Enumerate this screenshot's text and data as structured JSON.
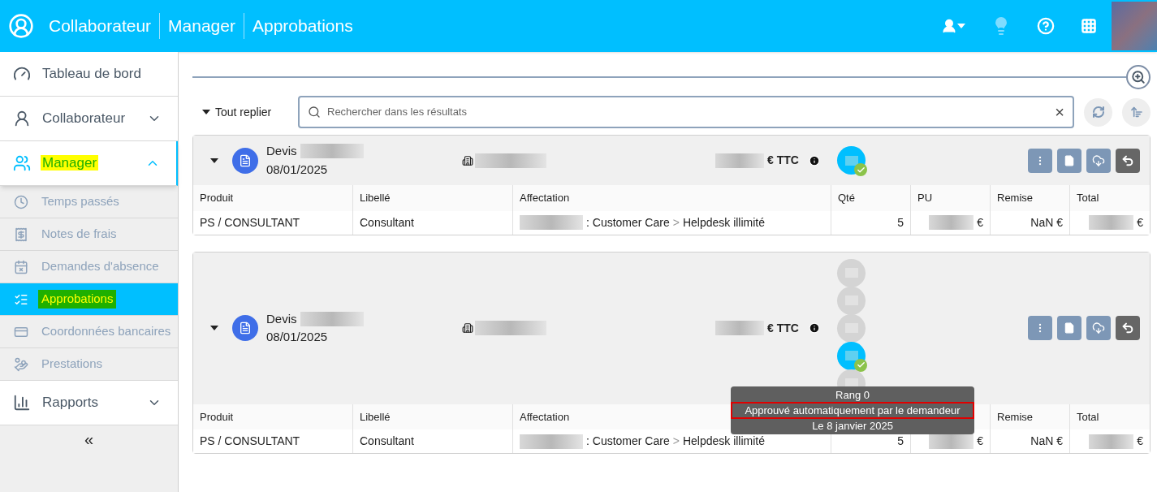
{
  "header": {
    "breadcrumb": [
      "Collaborateur",
      "Manager",
      "Approbations"
    ]
  },
  "sidebar": {
    "items": [
      {
        "label": "Tableau de bord",
        "kind": "section",
        "selected": false,
        "highlighted": false
      },
      {
        "label": "Collaborateur",
        "kind": "section",
        "selected": false,
        "highlighted": false,
        "expanded": false
      },
      {
        "label": "Manager",
        "kind": "section",
        "selected": true,
        "expanded": true,
        "highlighted": true,
        "children": [
          {
            "label": "Temps passés",
            "kind": "sub",
            "selected": false,
            "highlighted": false
          },
          {
            "label": "Notes de frais",
            "kind": "sub",
            "selected": false,
            "highlighted": false
          },
          {
            "label": "Demandes d'absence",
            "kind": "sub",
            "selected": false,
            "highlighted": false
          },
          {
            "label": "Approbations",
            "kind": "sub",
            "selected": true,
            "highlighted": true
          },
          {
            "label": "Coordonnées bancaires",
            "kind": "sub",
            "selected": false,
            "highlighted": false
          },
          {
            "label": "Prestations",
            "kind": "sub",
            "selected": false,
            "highlighted": false
          }
        ]
      },
      {
        "label": "Rapports",
        "kind": "section",
        "selected": false,
        "highlighted": false,
        "expanded": false
      }
    ],
    "collapse": "«"
  },
  "toolbar": {
    "collapse_all": "Tout replier",
    "search": {
      "placeholder": "Rechercher dans les résultats",
      "clear": "×"
    }
  },
  "quotes": [
    {
      "title": "Devis",
      "date": "08/01/2025",
      "amount_suffix": "€ TTC",
      "approvers": [
        {
          "approved": true
        }
      ],
      "columns": [
        "Produit",
        "Libellé",
        "Affectation",
        "Qté",
        "PU",
        "Remise",
        "Total"
      ],
      "rows": [
        {
          "produit": "PS / CONSULTANT",
          "libelle": "Consultant",
          "affectation": [
            ": Customer Care",
            ">",
            "Helpdesk illimité"
          ],
          "qte": "5",
          "pu": "€",
          "remise": "NaN €",
          "total": "€"
        }
      ]
    },
    {
      "title": "Devis",
      "date": "08/01/2025",
      "amount_suffix": "€ TTC",
      "approvers": [
        {
          "approved": false
        },
        {
          "approved": false
        },
        {
          "approved": false
        },
        {
          "approved": true
        },
        {
          "approved": false
        }
      ],
      "tooltip": {
        "lines": [
          {
            "text": "Rang 0",
            "highlighted": false
          },
          {
            "text": "Approuvé automatiquement par le demandeur",
            "highlighted": true
          },
          {
            "text": "Le 8 janvier 2025",
            "highlighted": false
          }
        ]
      },
      "columns": [
        "Produit",
        "Libellé",
        "Affectation",
        null,
        null,
        "Remise",
        "Total"
      ],
      "rows": [
        {
          "produit": "PS / CONSULTANT",
          "libelle": "Consultant",
          "affectation": [
            ": Customer Care",
            ">",
            "Helpdesk illimité"
          ],
          "qte": "5",
          "pu": "€",
          "remise": "NaN €",
          "total": "€"
        }
      ]
    }
  ]
}
